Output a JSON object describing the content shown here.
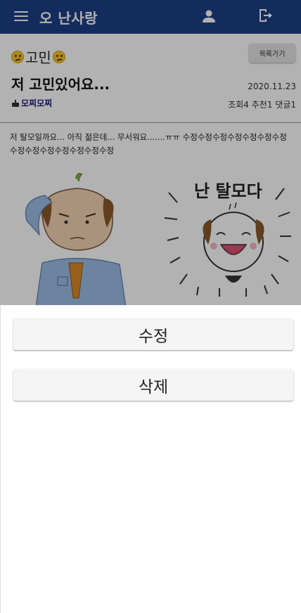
{
  "appbar": {
    "brand": "오 난사랑",
    "menu_icon": "hamburger-menu-icon",
    "user_icon": "person-icon",
    "logout_icon": "logout-icon"
  },
  "post": {
    "category": "고민",
    "list_button_label": "목록가기",
    "title": "저 고민있어요...",
    "date": "2020.11.23",
    "author": "모찌모찌",
    "stats": "조회4 추천1 댓글1",
    "body": "저 탈모일까요... 아직 젊은데... 무서워요.......ㅠㅠ 수정수정수정수정수정수정수정수정수정수정수정수정수정수정",
    "image_caption": "난 탈모다"
  },
  "sheet": {
    "edit_label": "수정",
    "delete_label": "삭제"
  },
  "colors": {
    "appbar": "#1e3f86",
    "author": "#1a1a7a",
    "overlay": "rgba(0,0,0,0.30)"
  }
}
